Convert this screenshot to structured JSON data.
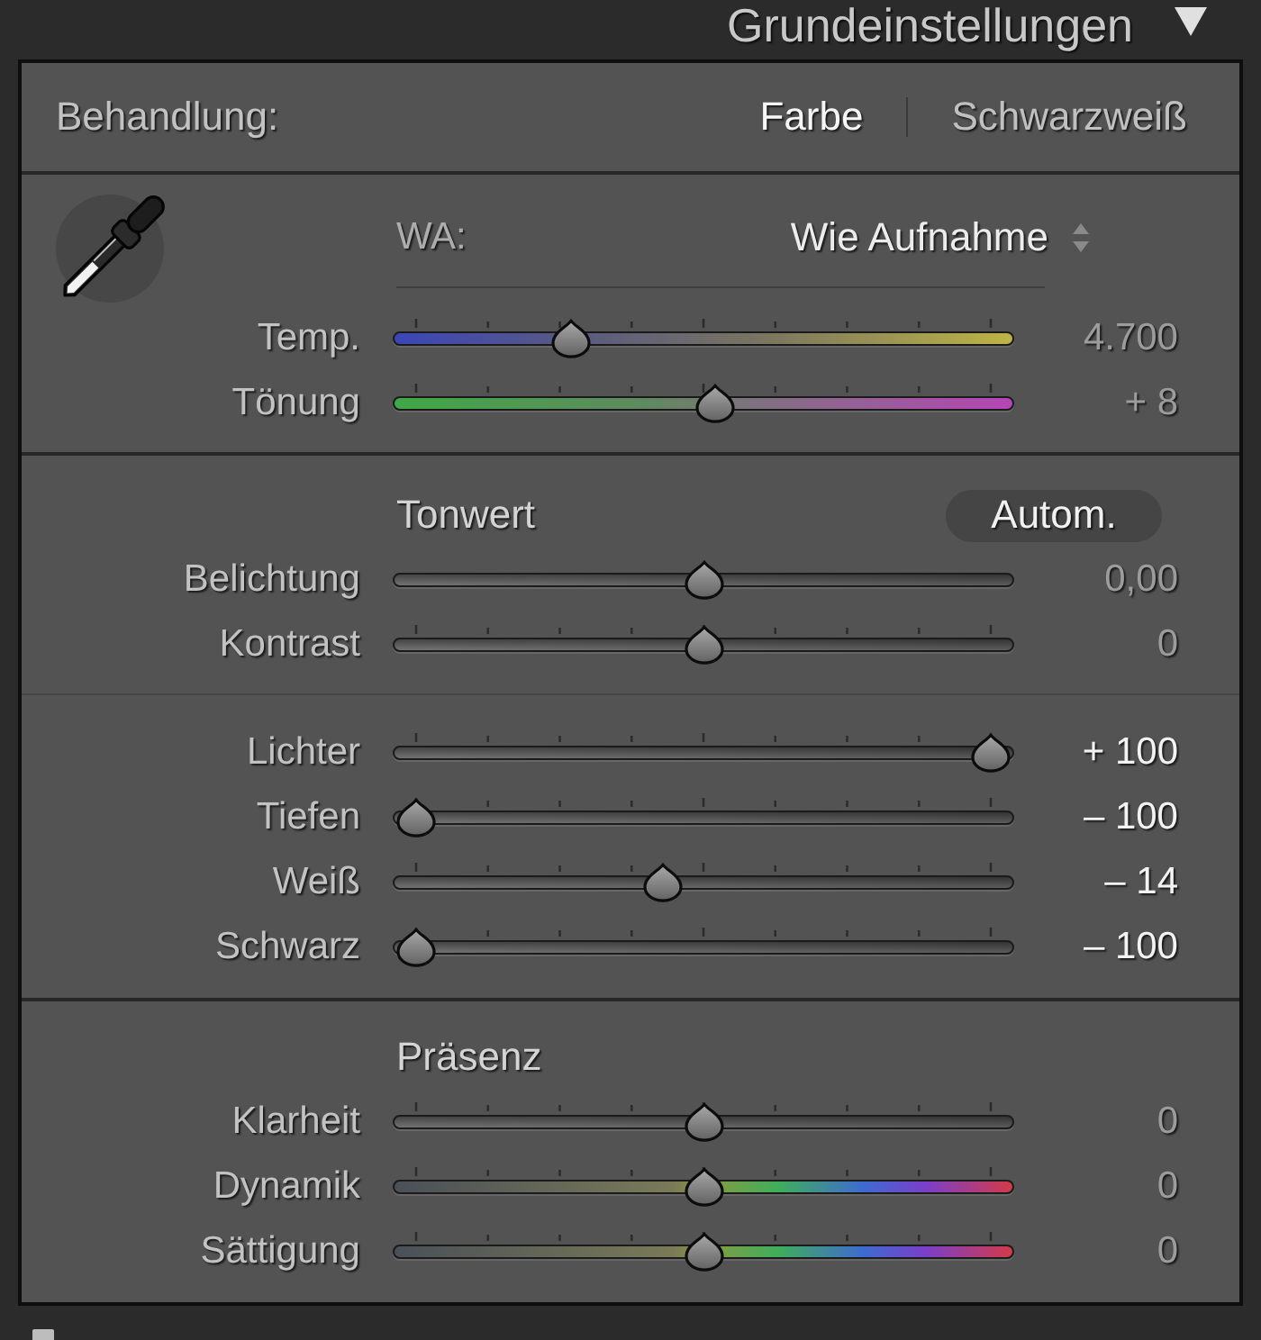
{
  "panel": {
    "title": "Grundeinstellungen",
    "expanded": true
  },
  "treatment": {
    "label": "Behandlung:",
    "options": [
      {
        "label": "Farbe",
        "selected": true
      },
      {
        "label": "Schwarzweiß",
        "selected": false
      }
    ]
  },
  "white_balance": {
    "label": "WA:",
    "value": "Wie Aufnahme",
    "sliders": [
      {
        "label": "Temp.",
        "kind": "temperature",
        "ticks": true,
        "level": 0.27,
        "value": "4.700",
        "highlighted": false
      },
      {
        "label": "Tönung",
        "kind": "tint",
        "ticks": true,
        "level": 0.52,
        "value": "+ 8",
        "highlighted": false
      }
    ]
  },
  "sections": [
    {
      "title": "Tonwert",
      "button": "Autom.",
      "groups": [
        {
          "sliders": [
            {
              "label": "Belichtung",
              "kind": "plain",
              "ticks": false,
              "level": 0.5,
              "value": "0,00",
              "highlighted": false
            },
            {
              "label": "Kontrast",
              "kind": "plain",
              "ticks": true,
              "level": 0.5,
              "value": "0",
              "highlighted": false
            }
          ]
        },
        {
          "sliders": [
            {
              "label": "Lichter",
              "kind": "plain",
              "ticks": true,
              "level": 1,
              "value": "+ 100",
              "highlighted": true
            },
            {
              "label": "Tiefen",
              "kind": "plain",
              "ticks": true,
              "level": 0,
              "value": "– 100",
              "highlighted": true
            },
            {
              "label": "Weiß",
              "kind": "plain",
              "ticks": true,
              "level": 0.43,
              "value": "– 14",
              "highlighted": true
            },
            {
              "label": "Schwarz",
              "kind": "plain",
              "ticks": true,
              "level": 0,
              "value": "– 100",
              "highlighted": true
            }
          ]
        }
      ]
    },
    {
      "title": "Präsenz",
      "groups": [
        {
          "sliders": [
            {
              "label": "Klarheit",
              "kind": "plain",
              "ticks": true,
              "level": 0.5,
              "value": "0",
              "highlighted": false
            },
            {
              "label": "Dynamik",
              "kind": "saturation",
              "ticks": true,
              "level": 0.5,
              "value": "0",
              "highlighted": false
            },
            {
              "label": "Sättigung",
              "kind": "saturation",
              "ticks": true,
              "level": 0.5,
              "value": "0",
              "highlighted": false
            }
          ]
        }
      ]
    }
  ]
}
